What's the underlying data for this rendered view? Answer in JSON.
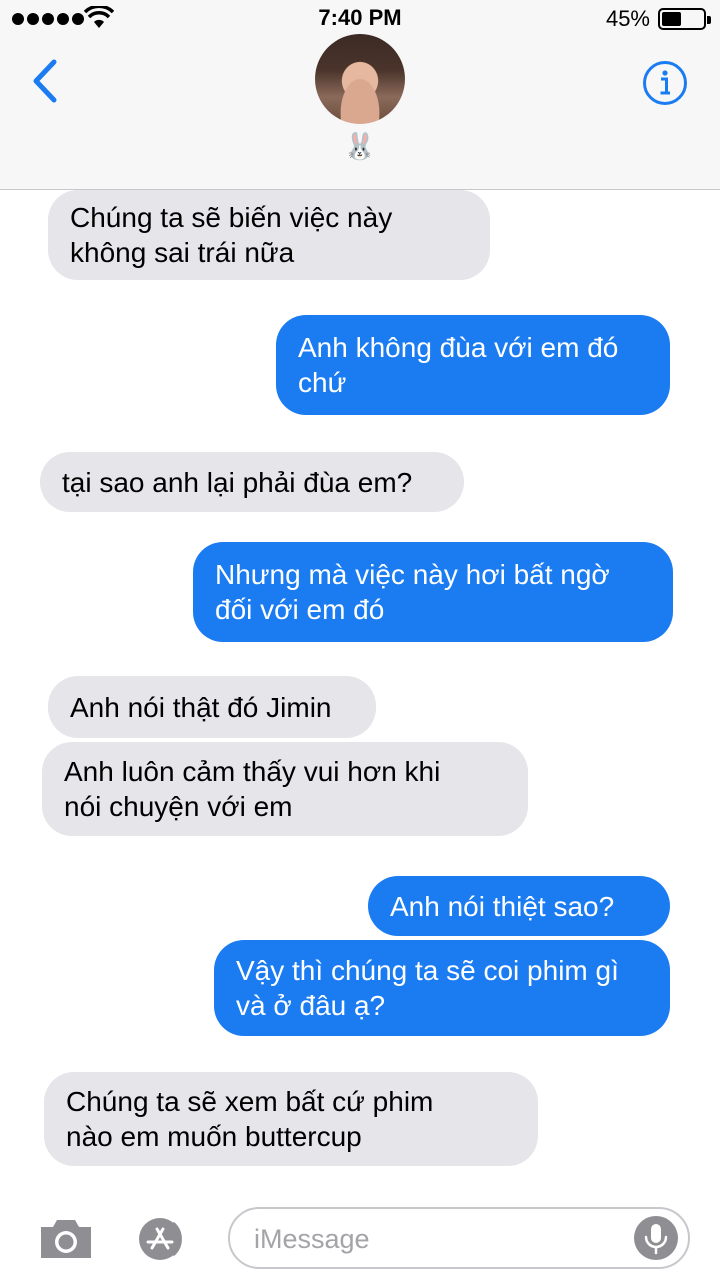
{
  "status_bar": {
    "time": "7:40 PM",
    "battery_percent": "45%",
    "battery_level": 0.45,
    "signal_dots": 5
  },
  "header": {
    "contact_emoji": "🐰",
    "back_icon": "chevron-left-icon",
    "info_icon": "info-icon"
  },
  "messages": [
    {
      "side": "received",
      "text": "Chúng ta sẽ biến việc này\nkhông sai trái nữa"
    },
    {
      "side": "sent",
      "text": "Anh không đùa với em đó\nchứ"
    },
    {
      "side": "received",
      "text": "tại sao anh lại phải đùa em?"
    },
    {
      "side": "sent",
      "text": "Nhưng mà việc này hơi bất ngờ\nđối với em đó"
    },
    {
      "side": "received",
      "text": "Anh nói thật đó Jimin"
    },
    {
      "side": "received",
      "text": "Anh luôn cảm thấy vui hơn khi\nnói chuyện với em"
    },
    {
      "side": "sent",
      "text": "Anh nói thiệt sao?"
    },
    {
      "side": "sent",
      "text": "Vậy thì chúng ta sẽ coi phim gì\nvà ở đâu ạ?"
    },
    {
      "side": "received",
      "text": "Chúng ta sẽ xem bất cứ phim\nnào em muốn buttercup"
    }
  ],
  "input_bar": {
    "placeholder": "iMessage",
    "value": ""
  },
  "colors": {
    "sent_bubble": "#1b7cf2",
    "received_bubble": "#e5e5ea",
    "accent": "#1b7cf2"
  }
}
